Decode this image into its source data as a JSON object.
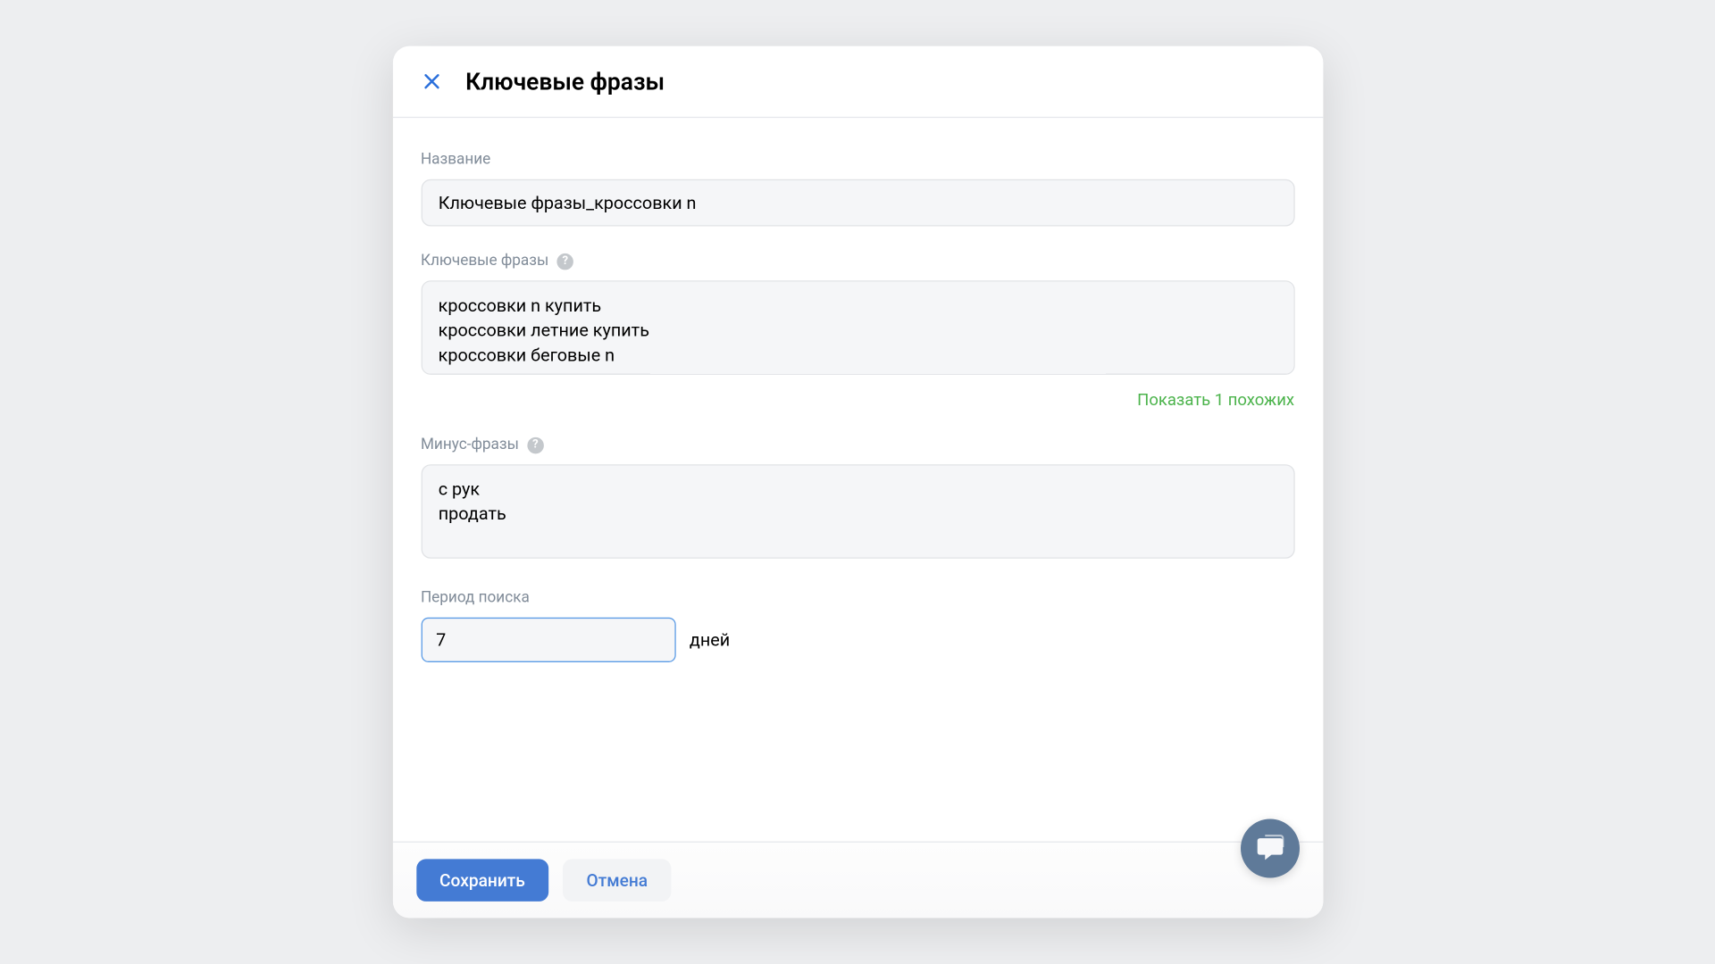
{
  "modal": {
    "title": "Ключевые фразы"
  },
  "fields": {
    "name": {
      "label": "Название",
      "value": "Ключевые фразы_кроссовки n"
    },
    "keywords": {
      "label": "Ключевые фразы",
      "value": "кроссовки n купить\nкроссовки летние купить\nкроссовки беговые n",
      "similar_link": "Показать 1 похожих"
    },
    "negative": {
      "label": "Минус-фразы",
      "value": "с рук\nпродать"
    },
    "period": {
      "label": "Период поиска",
      "value": "7",
      "unit": "дней"
    }
  },
  "footer": {
    "save": "Сохранить",
    "cancel": "Отмена"
  }
}
